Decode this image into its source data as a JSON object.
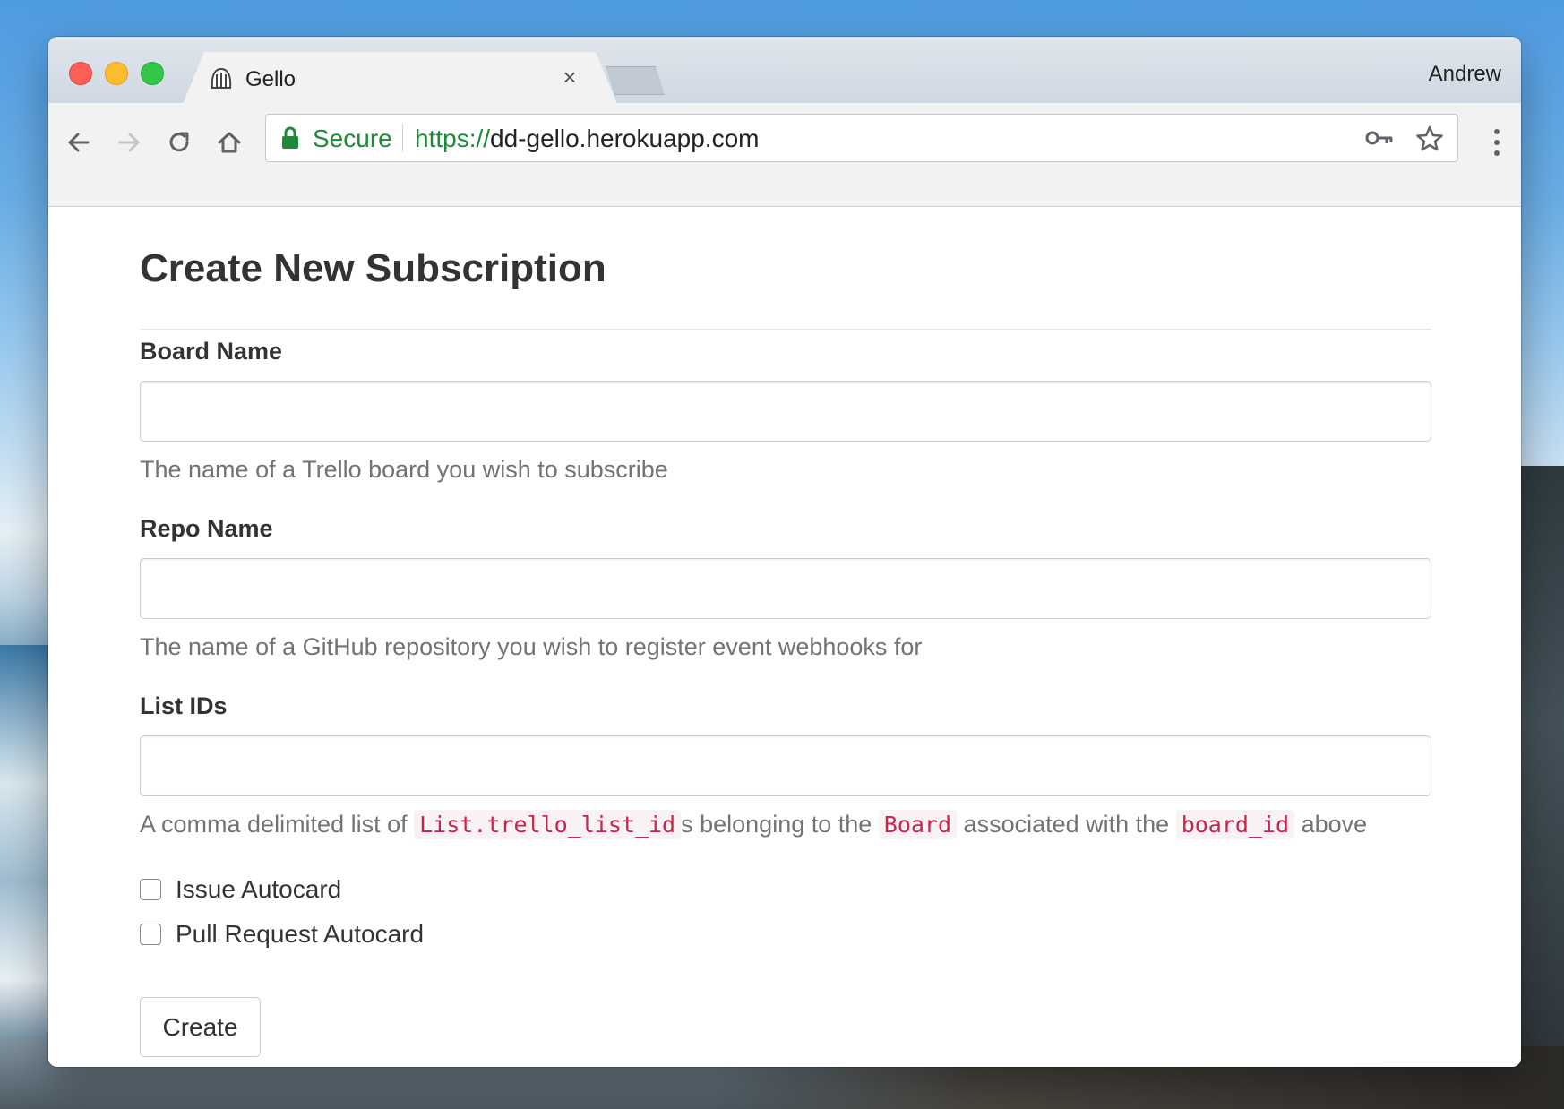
{
  "window": {
    "tab_title": "Gello",
    "tab_close_glyph": "×",
    "profile_name": "Andrew"
  },
  "toolbar": {
    "secure_label": "Secure",
    "url_scheme": "https://",
    "url_host": "dd-gello.herokuapp.com"
  },
  "icons": {
    "favicon": "gello-favicon-icon",
    "back": "arrow-left-icon",
    "forward": "arrow-right-icon",
    "reload": "reload-icon",
    "home": "home-icon",
    "lock": "lock-icon",
    "key": "key-icon",
    "bookmark": "star-icon",
    "menu": "vertical-dots-icon"
  },
  "colors": {
    "secure_green": "#1e8a3a",
    "code_red": "#c7254e",
    "code_bg": "#f9f2f4",
    "help_gray": "#737373"
  },
  "page": {
    "title": "Create New Subscription",
    "board_name": {
      "label": "Board Name",
      "value": "",
      "help": "The name of a Trello board you wish to subscribe"
    },
    "repo_name": {
      "label": "Repo Name",
      "value": "",
      "help": "The name of a GitHub repository you wish to register event webhooks for"
    },
    "list_ids": {
      "label": "List IDs",
      "value": "",
      "help_parts": {
        "p1": "A comma delimited list of ",
        "code1": "List.trello_list_id",
        "p2": "s belonging to the ",
        "code2": "Board",
        "p3": " associated with the ",
        "code3": "board_id",
        "p4": " above"
      }
    },
    "checkboxes": {
      "issue_autocard": {
        "label": "Issue Autocard",
        "checked": false
      },
      "pull_request_autocard": {
        "label": "Pull Request Autocard",
        "checked": false
      }
    },
    "submit_label": "Create"
  }
}
